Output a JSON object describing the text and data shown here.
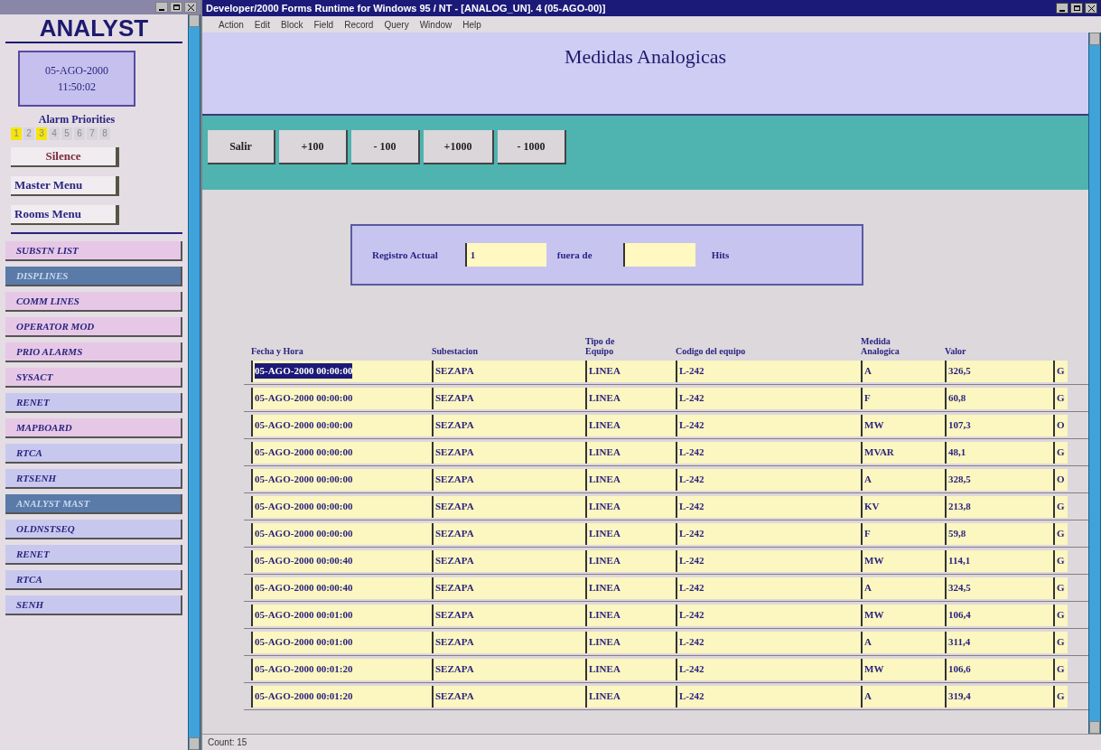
{
  "left_panel": {
    "title": "ANALYST",
    "date": "05-AGO-2000",
    "time": "11:50:02",
    "alarm_label": "Alarm Priorities",
    "alarm_priorities": [
      {
        "label": "1",
        "color": "#f5e50a"
      },
      {
        "label": "2",
        "color": "#d8d4dc"
      },
      {
        "label": "3",
        "color": "#f5e50a"
      },
      {
        "label": "4",
        "color": "#d8d4dc"
      },
      {
        "label": "5",
        "color": "#d8d4dc"
      },
      {
        "label": "6",
        "color": "#d8d4dc"
      },
      {
        "label": "7",
        "color": "#d8d4dc"
      },
      {
        "label": "8",
        "color": "#d8d4dc"
      }
    ],
    "buttons": [
      "Silence",
      "Master Menu",
      "Rooms Menu"
    ],
    "items": [
      {
        "label": "SUBSTN LIST",
        "color": "#e6c8e6",
        "selected": false
      },
      {
        "label": "DISPLINES",
        "color": "#5a7aa8",
        "selected": true
      },
      {
        "label": "COMM LINES",
        "color": "#e6c8e6",
        "selected": false
      },
      {
        "label": "OPERATOR MOD",
        "color": "#e6c8e6",
        "selected": false
      },
      {
        "label": "PRIO ALARMS",
        "color": "#e6c8e6",
        "selected": false
      },
      {
        "label": "SYSACT",
        "color": "#e6c8e6",
        "selected": false
      },
      {
        "label": "RENET",
        "color": "#c8c8ee",
        "selected": false
      },
      {
        "label": "MAPBOARD",
        "color": "#e6c8e6",
        "selected": false
      },
      {
        "label": "RTCA",
        "color": "#c8c8ee",
        "selected": false
      },
      {
        "label": "RTSENH",
        "color": "#c8c8ee",
        "selected": false
      },
      {
        "label": "ANALYST MAST",
        "color": "#5a7aa8",
        "selected": true
      },
      {
        "label": "OLDNSTSEQ",
        "color": "#c8c8ee",
        "selected": false
      },
      {
        "label": "RENET",
        "color": "#c8c8ee",
        "selected": false
      },
      {
        "label": "RTCA",
        "color": "#c8c8ee",
        "selected": false
      },
      {
        "label": "SENH",
        "color": "#c8c8ee",
        "selected": false
      }
    ]
  },
  "window": {
    "title": "Developer/2000 Forms Runtime for Windows 95 / NT - [ANALOG_UN]. 4 (05-AGO-00)]",
    "menu": [
      "Action",
      "Edit",
      "Block",
      "Field",
      "Record",
      "Query",
      "Window",
      "Help"
    ]
  },
  "form": {
    "title": "Medidas Analogicas",
    "buttons": [
      "Salir",
      "+100",
      "- 100",
      "+1000",
      "- 1000"
    ],
    "record_label": "Registro Actual",
    "record_value": "1",
    "of_label": "fuera de",
    "hits_label": "Hits"
  },
  "table": {
    "columns": [
      "Fecha y Hora",
      "Subestacion",
      "Tipo de Equipo",
      "Codigo del equipo",
      "Medida Analogica",
      "Valor"
    ],
    "rows": [
      {
        "selected": true,
        "cells": [
          "05-AGO-2000 00:00:00",
          "SEZAPA",
          "LINEA",
          "L-242",
          "A",
          "326,5",
          "G"
        ]
      },
      {
        "selected": false,
        "cells": [
          "05-AGO-2000 00:00:00",
          "SEZAPA",
          "LINEA",
          "L-242",
          "F",
          "60,8",
          "G"
        ]
      },
      {
        "selected": false,
        "cells": [
          "05-AGO-2000 00:00:00",
          "SEZAPA",
          "LINEA",
          "L-242",
          "MW",
          "107,3",
          "O"
        ]
      },
      {
        "selected": false,
        "cells": [
          "05-AGO-2000 00:00:00",
          "SEZAPA",
          "LINEA",
          "L-242",
          "MVAR",
          "48,1",
          "G"
        ]
      },
      {
        "selected": false,
        "cells": [
          "05-AGO-2000 00:00:00",
          "SEZAPA",
          "LINEA",
          "L-242",
          "A",
          "328,5",
          "O"
        ]
      },
      {
        "selected": false,
        "cells": [
          "05-AGO-2000 00:00:00",
          "SEZAPA",
          "LINEA",
          "L-242",
          "KV",
          "213,8",
          "G"
        ]
      },
      {
        "selected": false,
        "cells": [
          "05-AGO-2000 00:00:00",
          "SEZAPA",
          "LINEA",
          "L-242",
          "F",
          "59,8",
          "G"
        ]
      },
      {
        "selected": false,
        "cells": [
          "05-AGO-2000 00:00:40",
          "SEZAPA",
          "LINEA",
          "L-242",
          "MW",
          "114,1",
          "G"
        ]
      },
      {
        "selected": false,
        "cells": [
          "05-AGO-2000 00:00:40",
          "SEZAPA",
          "LINEA",
          "L-242",
          "A",
          "324,5",
          "G"
        ]
      },
      {
        "selected": false,
        "cells": [
          "05-AGO-2000 00:01:00",
          "SEZAPA",
          "LINEA",
          "L-242",
          "MW",
          "106,4",
          "G"
        ]
      },
      {
        "selected": false,
        "cells": [
          "05-AGO-2000 00:01:00",
          "SEZAPA",
          "LINEA",
          "L-242",
          "A",
          "311,4",
          "G"
        ]
      },
      {
        "selected": false,
        "cells": [
          "05-AGO-2000 00:01:20",
          "SEZAPA",
          "LINEA",
          "L-242",
          "MW",
          "106,6",
          "G"
        ]
      },
      {
        "selected": false,
        "cells": [
          "05-AGO-2000 00:01:20",
          "SEZAPA",
          "LINEA",
          "L-242",
          "A",
          "319,4",
          "G"
        ]
      }
    ]
  },
  "status_bar": {
    "text": "Count: 15"
  }
}
